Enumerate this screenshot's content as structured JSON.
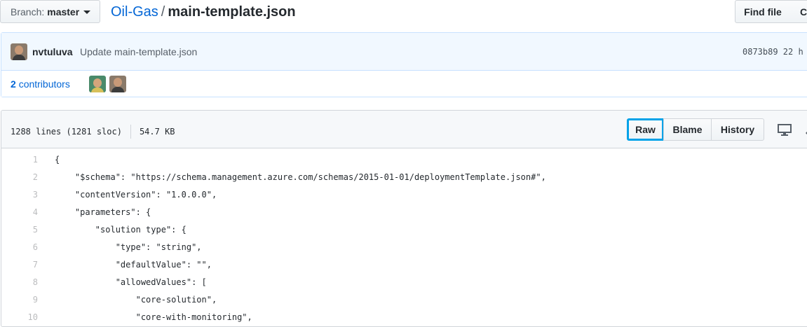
{
  "branch": {
    "prefix": "Branch:",
    "name": "master"
  },
  "breadcrumb": {
    "repo": "Oil-Gas",
    "separator": "/",
    "file": "main-template.json"
  },
  "toolbar": {
    "find_file": "Find file",
    "copy_path_partial": "C"
  },
  "commit": {
    "author": "nvtuluva",
    "message": "Update main-template.json",
    "sha_time": "0873b89 22 h"
  },
  "contributors": {
    "count": "2",
    "label": "contributors"
  },
  "file_info": {
    "lines": "1288 lines (1281 sloc)",
    "size": "54.7 KB"
  },
  "file_actions": {
    "raw": "Raw",
    "blame": "Blame",
    "history": "History"
  },
  "icons": [
    "desktop-icon",
    "pencil-icon",
    "caret-down-icon"
  ],
  "code_lines": [
    {
      "n": "1",
      "t": "{"
    },
    {
      "n": "2",
      "t": "    \"$schema\": \"https://schema.management.azure.com/schemas/2015-01-01/deploymentTemplate.json#\","
    },
    {
      "n": "3",
      "t": "    \"contentVersion\": \"1.0.0.0\","
    },
    {
      "n": "4",
      "t": "    \"parameters\": {"
    },
    {
      "n": "5",
      "t": "        \"solution type\": {"
    },
    {
      "n": "6",
      "t": "            \"type\": \"string\","
    },
    {
      "n": "7",
      "t": "            \"defaultValue\": \"\","
    },
    {
      "n": "8",
      "t": "            \"allowedValues\": ["
    },
    {
      "n": "9",
      "t": "                \"core-solution\","
    },
    {
      "n": "10",
      "t": "                \"core-with-monitoring\","
    }
  ]
}
